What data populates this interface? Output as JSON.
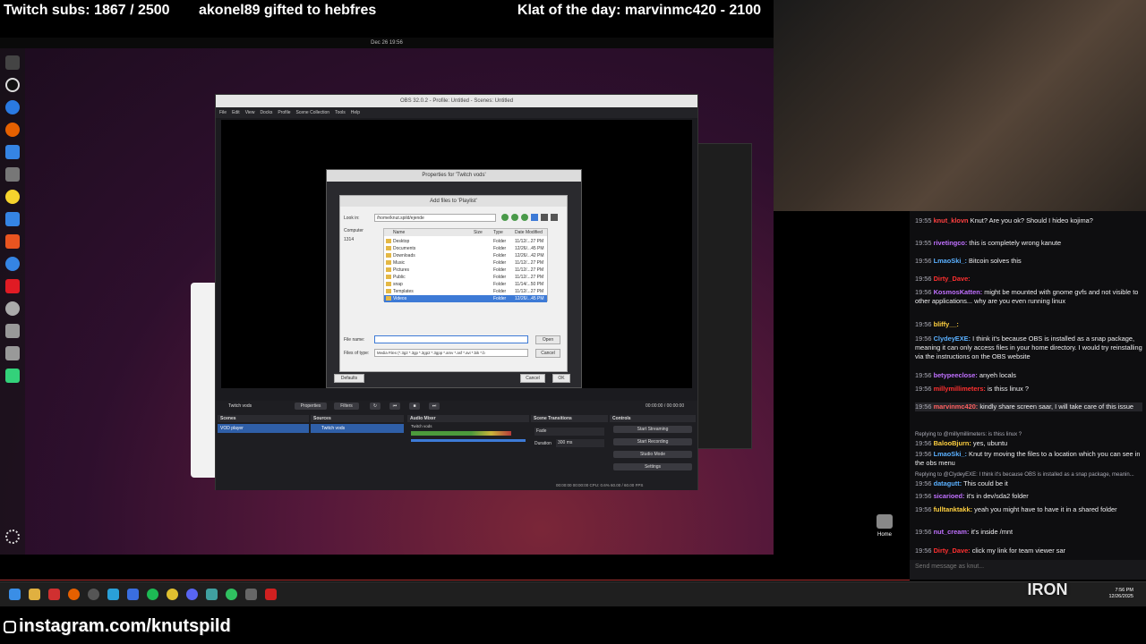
{
  "overlay": {
    "subs": "Twitch subs: 1867 / 2500",
    "gift": "akonel89 gifted to hebfres",
    "klat": "Klat of the day: marvinmc420 - 2100",
    "instagram": "instagram.com/knutspild",
    "logo": "IRON"
  },
  "gnome": {
    "clock": "Dec 26  19:56",
    "home_label": "Home"
  },
  "obs": {
    "title": "OBS 32.0.2 - Profile: Untitled - Scenes: Untitled",
    "menu": [
      "File",
      "Edit",
      "View",
      "Docks",
      "Profile",
      "Scene Collection",
      "Tools",
      "Help"
    ],
    "props_title": "Properties for 'Twitch vods'",
    "defaults": "Defaults",
    "cancel": "Cancel",
    "ok": "OK",
    "source_name": "Twitch vods",
    "properties_btn": "Properties",
    "filters_btn": "Filters",
    "time": "00:00:00 / 00:00:00",
    "docks": {
      "scenes": "Scenes",
      "sources": "Sources",
      "mixer": "Audio Mixer",
      "transitions": "Scene Transitions",
      "controls": "Controls"
    },
    "scene_item": "VOD player",
    "source_item": "Twitch vods",
    "mixer_item": "Twitch vods",
    "transition": "Fade",
    "duration_label": "Duration",
    "duration": "300 ms",
    "controls": [
      "Start Streaming",
      "Start Recording",
      "Studio Mode",
      "Settings"
    ],
    "status": "00:00:00   00:00:00   CPU: 0.6%   60.00 / 60.00 FPS"
  },
  "dialog": {
    "title": "Add files to 'Playlist'",
    "look_in_label": "Look in:",
    "look_in": "/home/knut.spild/ejende",
    "places": [
      "Computer",
      "1314"
    ],
    "columns": [
      "Name",
      "Size",
      "Type",
      "Date Modified"
    ],
    "files": [
      {
        "name": "Desktop",
        "type": "Folder",
        "date": "11/12/...27 PM"
      },
      {
        "name": "Documents",
        "type": "Folder",
        "date": "12/26/...45 PM"
      },
      {
        "name": "Downloads",
        "type": "Folder",
        "date": "12/26/...42 PM"
      },
      {
        "name": "Music",
        "type": "Folder",
        "date": "11/12/...27 PM"
      },
      {
        "name": "Pictures",
        "type": "Folder",
        "date": "11/12/...27 PM"
      },
      {
        "name": "Public",
        "type": "Folder",
        "date": "11/12/...27 PM"
      },
      {
        "name": "snap",
        "type": "Folder",
        "date": "11/14/...50 PM"
      },
      {
        "name": "Templates",
        "type": "Folder",
        "date": "11/12/...27 PM"
      },
      {
        "name": "Videos",
        "type": "Folder",
        "date": "12/26/...45 PM"
      }
    ],
    "file_name_label": "File name:",
    "file_name": "",
    "file_type_label": "Files of type:",
    "file_type": "Media Files (*.3g2 *.3gp *.3gp2 *.3gpp *.amv *.asf *.avi *.bik *.b",
    "open": "Open",
    "cancel": "Cancel"
  },
  "chat": {
    "placeholder": "Send message as knut...",
    "messages": [
      {
        "ts": "19:55",
        "user": "knut_klovn",
        "color": "#ff4040",
        "text": "Knut? Are you ok? Should I      hideo kojima?"
      },
      {
        "ts": "19:55",
        "user": "rivetingco:",
        "color": "#c070ff",
        "text": "this is completely wrong kanute"
      },
      {
        "ts": "19:56",
        "user": "LmaoSki_:",
        "color": "#5ab0ff",
        "text": "Bitcoin solves this"
      },
      {
        "ts": "19:56",
        "user": "Dirty_Dave:",
        "color": "#ff3030",
        "text": ""
      },
      {
        "ts": "19:56",
        "user": "KosmosKatten:",
        "color": "#c070ff",
        "text": "might be mounted with gnome gvfs and not visible to other applications... why are you even running linux"
      },
      {
        "ts": "19:56",
        "user": "bliffy__:",
        "color": "#ffd040",
        "text": ""
      },
      {
        "ts": "19:56",
        "user": "ClydeyEXE:",
        "color": "#5ab0ff",
        "text": "I think it's because OBS is installed as a snap package, meaning it can only access files in your home directory. I would try reinstalling via the instructions on the OBS website"
      },
      {
        "ts": "19:56",
        "user": "betypeeclose:",
        "color": "#c070ff",
        "text": "anyeh locals"
      },
      {
        "ts": "19:56",
        "user": "millymillimeters:",
        "color": "#ff3030",
        "text": "is thiss linux ?"
      },
      {
        "ts": "19:56",
        "user": "marvinmc420:",
        "color": "#ff6060",
        "text": "kindly share screen saar, I will take care of this issue"
      },
      {
        "ts": "19:56",
        "reply": "Replying to @millymillimeters: is thiss linux ?",
        "user": "BalooBjurn:",
        "color": "#ffd040",
        "text": "yes, ubuntu"
      },
      {
        "ts": "19:56",
        "user": "LmaoSki_:",
        "color": "#5ab0ff",
        "text": "Knut try moving the files to a location which you can see in the obs menu"
      },
      {
        "ts": "19:56",
        "reply": "Replying to @ClydeyEXE: I think it's because OBS is installed as a snap package, meanin...",
        "user": "datagutt:",
        "color": "#5ab0ff",
        "text": "This could be it"
      },
      {
        "ts": "19:56",
        "user": "sicarioed:",
        "color": "#c070ff",
        "text": "it's in dev/sda2 folder"
      },
      {
        "ts": "19:56",
        "user": "fulltanktakk:",
        "color": "#ffd040",
        "text": "yeah you might have to have it in a shared folder"
      },
      {
        "ts": "19:56",
        "user": "nut_cream:",
        "color": "#c070ff",
        "text": "it's inside /mnt"
      },
      {
        "ts": "19:56",
        "user": "Dirty_Dave:",
        "color": "#ff3030",
        "text": "click my link for team viewer sar"
      }
    ]
  },
  "taskbar": {
    "time": "7:56 PM",
    "date": "12/26/2025"
  }
}
